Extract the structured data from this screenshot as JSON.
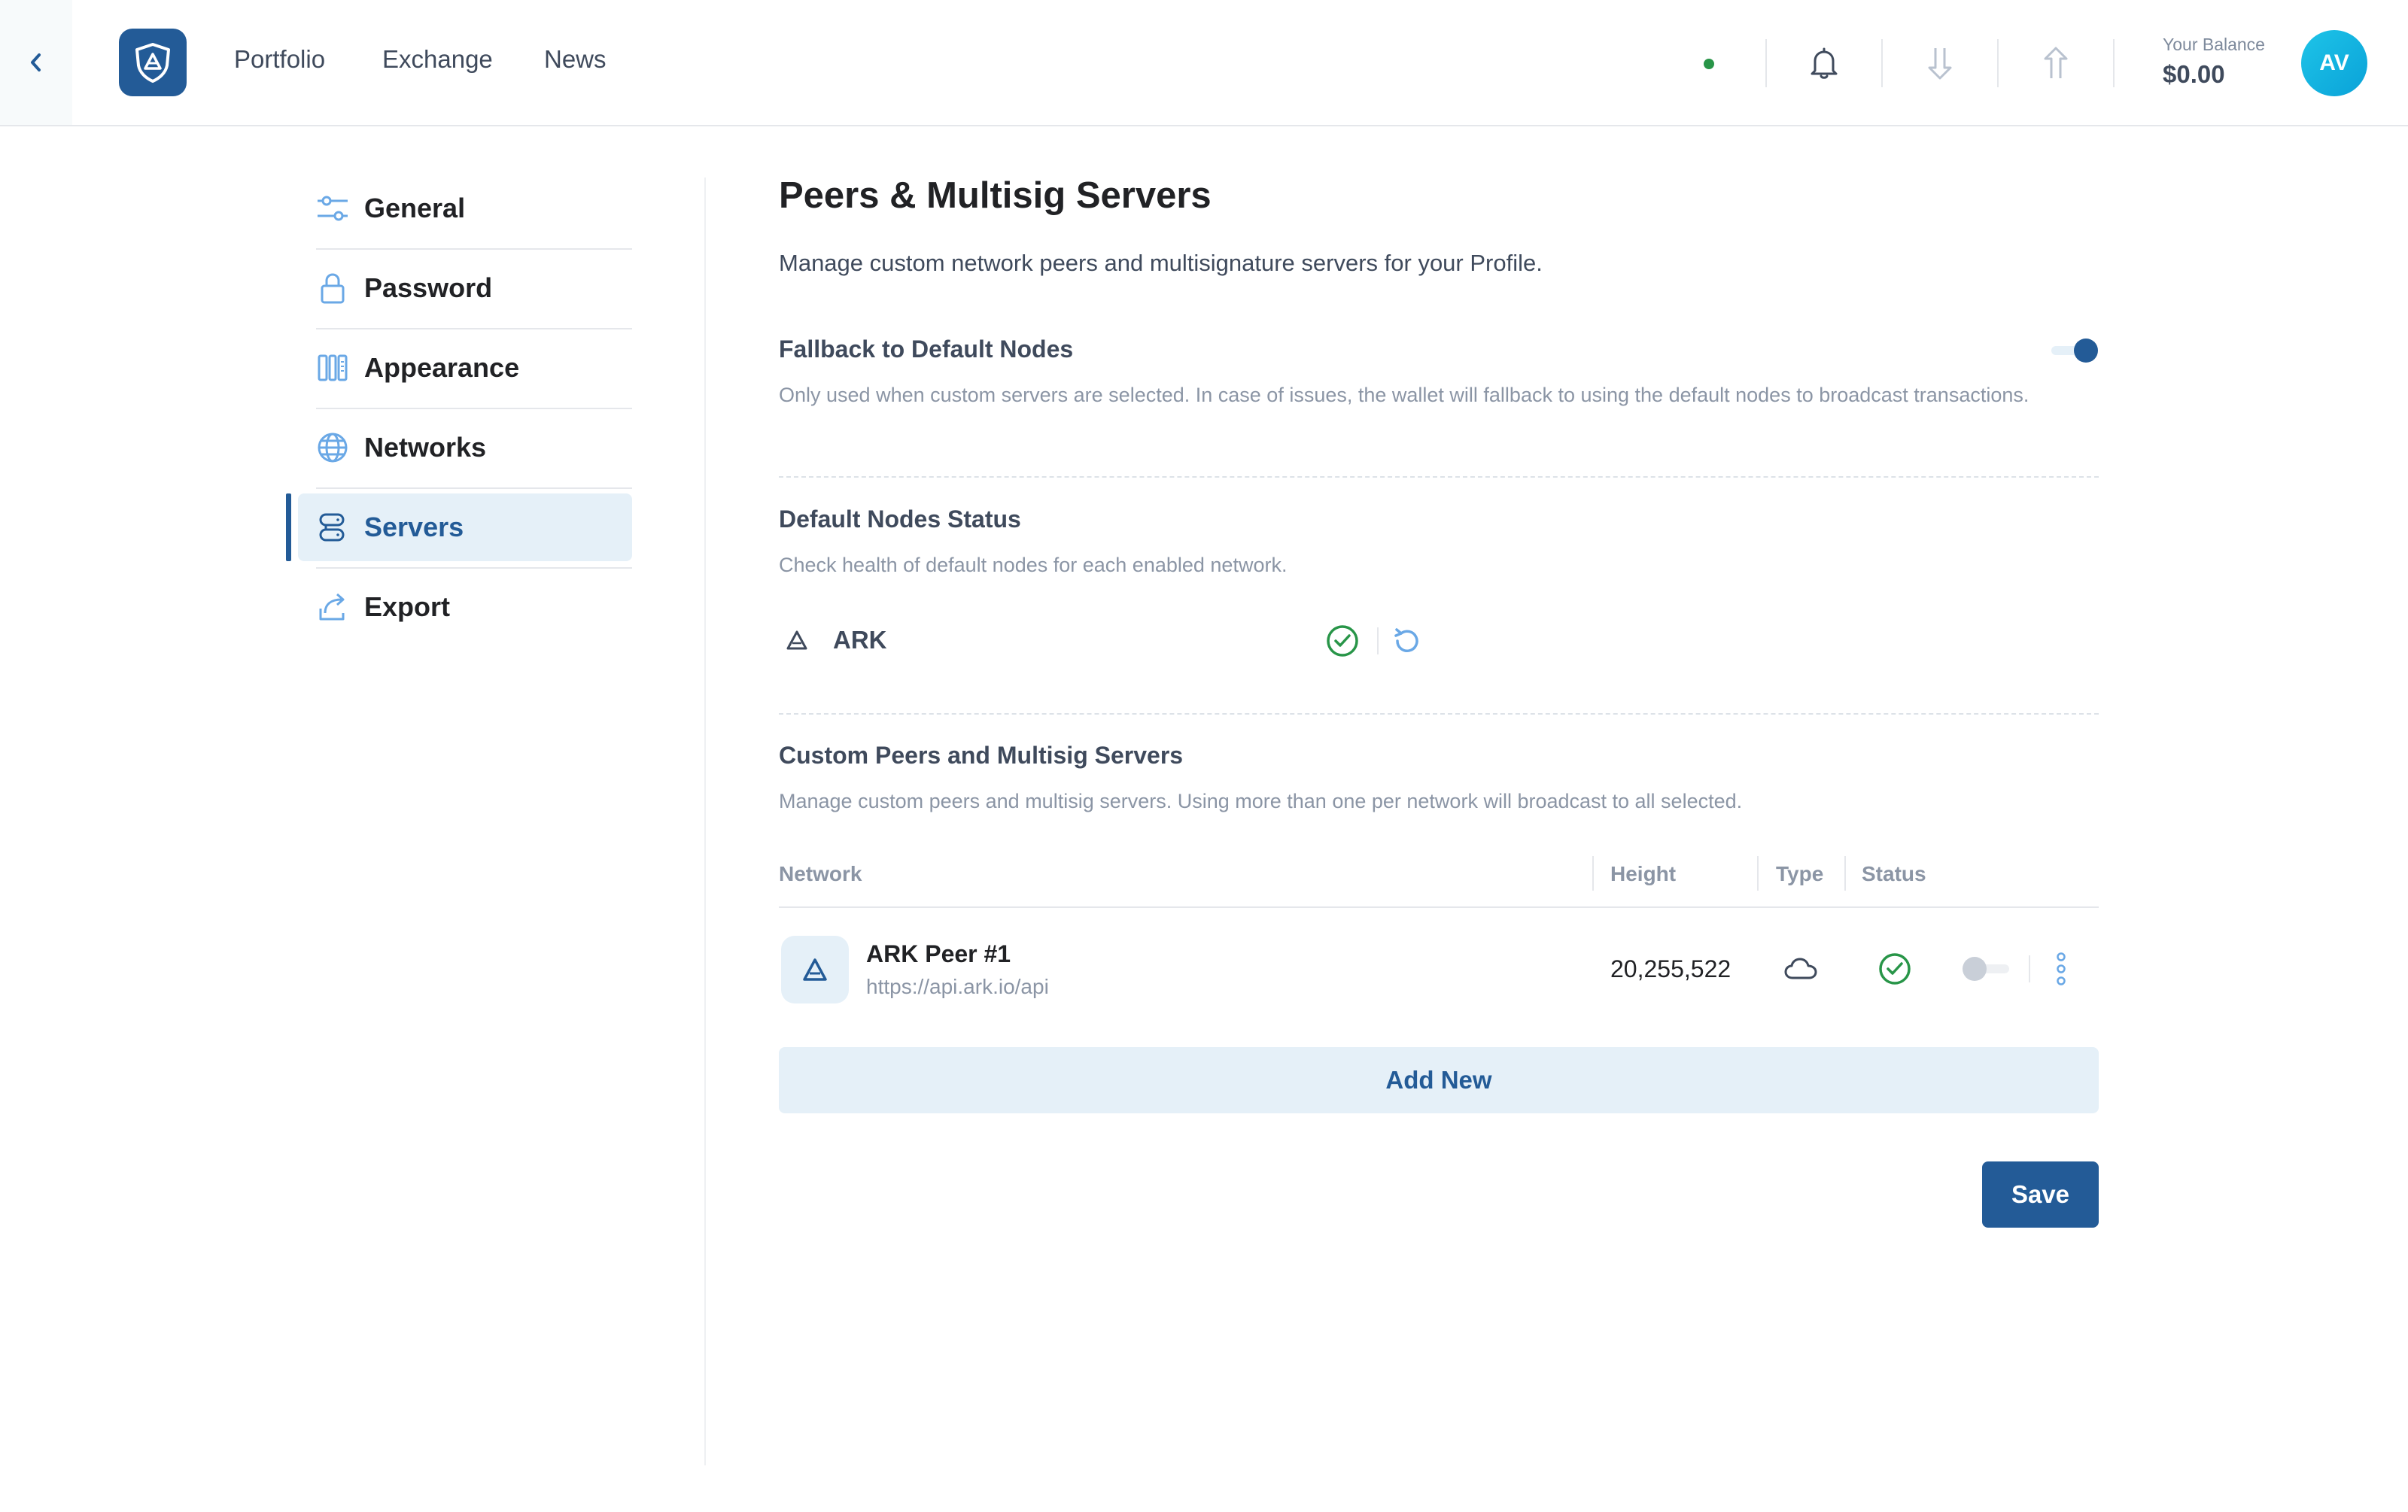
{
  "header": {
    "nav": [
      "Portfolio",
      "Exchange",
      "News"
    ],
    "balance_label": "Your Balance",
    "balance_value": "$0.00",
    "avatar_initials": "AV"
  },
  "sidebar": {
    "items": [
      {
        "label": "General",
        "icon": "sliders-icon"
      },
      {
        "label": "Password",
        "icon": "lock-icon"
      },
      {
        "label": "Appearance",
        "icon": "appearance-icon"
      },
      {
        "label": "Networks",
        "icon": "globe-icon"
      },
      {
        "label": "Servers",
        "icon": "server-icon",
        "active": true
      },
      {
        "label": "Export",
        "icon": "export-icon"
      }
    ]
  },
  "main": {
    "title": "Peers & Multisig Servers",
    "subtitle": "Manage custom network peers and multisignature servers for your Profile.",
    "fallback": {
      "title": "Fallback to Default Nodes",
      "description": "Only used when custom servers are selected. In case of issues, the wallet will fallback to using the default nodes to broadcast transactions.",
      "enabled": true
    },
    "default_nodes": {
      "title": "Default Nodes Status",
      "description": "Check health of default nodes for each enabled network.",
      "network": "ARK",
      "status": "healthy"
    },
    "custom": {
      "title": "Custom Peers and Multisig Servers",
      "description": "Manage custom peers and multisig servers. Using more than one per network will broadcast to all selected.",
      "columns": [
        "Network",
        "Height",
        "Type",
        "Status"
      ],
      "rows": [
        {
          "name": "ARK Peer #1",
          "url": "https://api.ark.io/api",
          "height": "20,255,522",
          "type": "cloud-icon",
          "status": "healthy",
          "enabled": false
        }
      ]
    },
    "add_new_label": "Add New",
    "save_label": "Save"
  },
  "colors": {
    "primary": "#235b97",
    "primary_light": "#e5f0f8",
    "success": "#289548",
    "muted": "#8b95a5"
  }
}
